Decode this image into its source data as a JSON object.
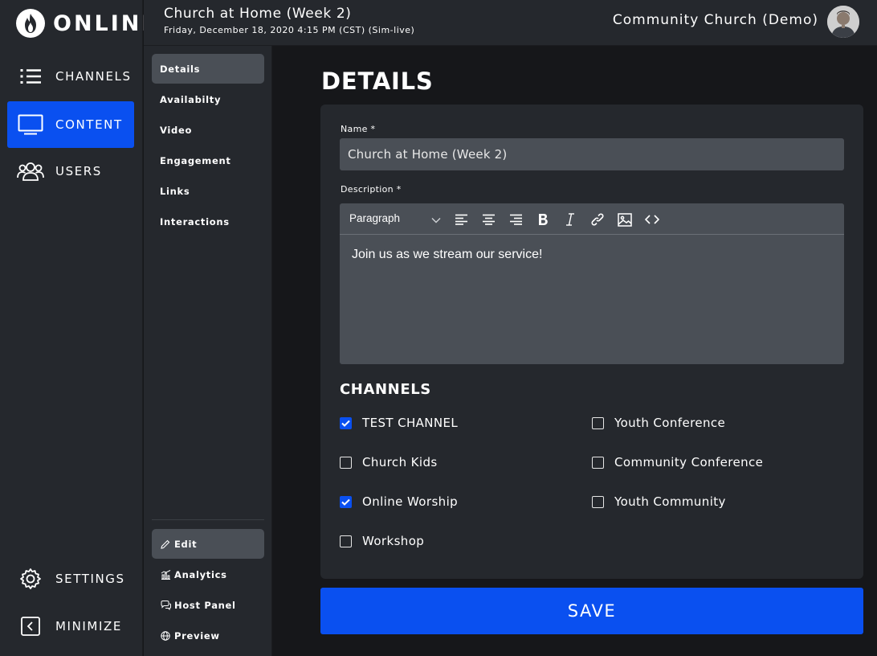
{
  "brand": {
    "wordmark": "ONLINE"
  },
  "nav": {
    "items": [
      {
        "label": "CHANNELS",
        "icon": "list-icon",
        "active": false
      },
      {
        "label": "CONTENT",
        "icon": "monitor-icon",
        "active": true
      },
      {
        "label": "USERS",
        "icon": "users-icon",
        "active": false
      }
    ],
    "bottom": [
      {
        "label": "SETTINGS",
        "icon": "gear-icon"
      },
      {
        "label": "MINIMIZE",
        "icon": "collapse-icon"
      }
    ]
  },
  "header": {
    "title": "Church at Home (Week 2)",
    "subtitle": "Friday, December 18, 2020 4:15 PM (CST) (Sim-live)",
    "organization": "Community Church (Demo)"
  },
  "subnav": {
    "items": [
      "Details",
      "Availabilty",
      "Video",
      "Engagement",
      "Links",
      "Interactions"
    ],
    "active": "Details",
    "bottom": [
      {
        "label": "Edit",
        "icon": "pencil-icon"
      },
      {
        "label": "Analytics",
        "icon": "bar-chart-icon"
      },
      {
        "label": "Host Panel",
        "icon": "chat-icon"
      },
      {
        "label": "Preview",
        "icon": "globe-icon"
      }
    ]
  },
  "details": {
    "title": "DETAILS",
    "name_label": "Name *",
    "name_value": "Church at Home (Week 2)",
    "description_label": "Description *",
    "editor": {
      "format": "Paragraph",
      "body": "Join us as we stream our service!"
    },
    "channels_heading": "CHANNELS",
    "channels": [
      {
        "label": "TEST CHANNEL",
        "checked": true
      },
      {
        "label": "Church Kids",
        "checked": false
      },
      {
        "label": "Online Worship",
        "checked": true
      },
      {
        "label": "Workshop",
        "checked": false
      },
      {
        "label": "Youth Conference",
        "checked": false
      },
      {
        "label": "Community Conference",
        "checked": false
      },
      {
        "label": "Youth Community",
        "checked": false
      }
    ],
    "save_label": "SAVE"
  },
  "colors": {
    "accent": "#0a50f0",
    "panel": "#25282d",
    "field": "#4a4f56",
    "background": "#16171a"
  }
}
